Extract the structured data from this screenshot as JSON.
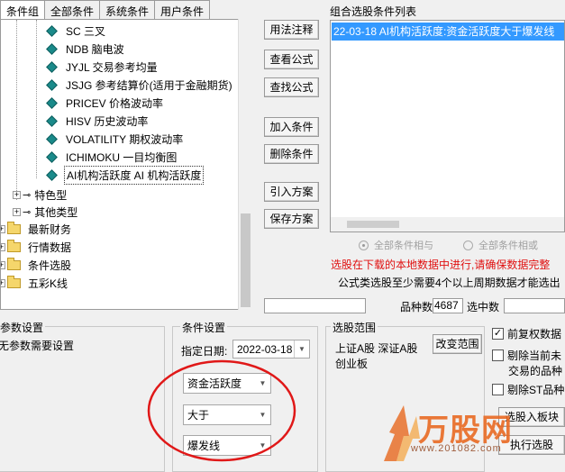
{
  "tabs": [
    "条件组",
    "全部条件",
    "系统条件",
    "用户条件"
  ],
  "tree": {
    "leaves": [
      "SC 三叉",
      "NDB 脑电波",
      "JYJL 交易参考均量",
      "JSJG 参考结算价(适用于金融期货)",
      "PRICEV 价格波动率",
      "HISV 历史波动率",
      "VOLATILITY 期权波动率",
      "ICHIMOKU 一目均衡图",
      "AI机构活跃度 AI 机构活跃度"
    ],
    "subgroups": [
      "特色型",
      "其他类型"
    ],
    "folders": [
      "最新财务",
      "行情数据",
      "条件选股",
      "五彩K线"
    ]
  },
  "buttons": {
    "usage": "用法注释",
    "view_formula": "查看公式",
    "find_formula": "查找公式",
    "add_condition": "加入条件",
    "delete_condition": "删除条件",
    "import_plan": "引入方案",
    "save_plan": "保存方案",
    "change_range": "改变范围",
    "select_to_block": "选股入板块",
    "run_select": "执行选股"
  },
  "combined": {
    "label": "组合选股条件列表",
    "item": "22-03-18 AI机构活跃度:资金活跃度大于爆发线",
    "radio_and": "全部条件相与",
    "radio_or": "全部条件相或",
    "warn": "选股在下载的本地数据中进行,请确保数据完整",
    "note": "公式类选股至少需要4个以上周期数据才能选出",
    "count_label": "品种数",
    "count_value": "4687",
    "selected_label": "选中数"
  },
  "params": {
    "title": "参数设置",
    "text": "无参数需要设置"
  },
  "cond": {
    "title": "条件设置",
    "date_label": "指定日期:",
    "date_value": "2022-03-18",
    "combo1": "资金活跃度",
    "combo2": "大于",
    "combo3": "爆发线"
  },
  "range": {
    "title": "选股范围",
    "text1": "上证A股 深证A股",
    "text2": "创业板"
  },
  "options": {
    "opt1": "前复权数据",
    "opt2a": "剔除当前未",
    "opt2b": "交易的品种",
    "opt3": "剔除ST品种"
  },
  "watermark": {
    "brand": "万股网",
    "url": "www.201082.com"
  }
}
